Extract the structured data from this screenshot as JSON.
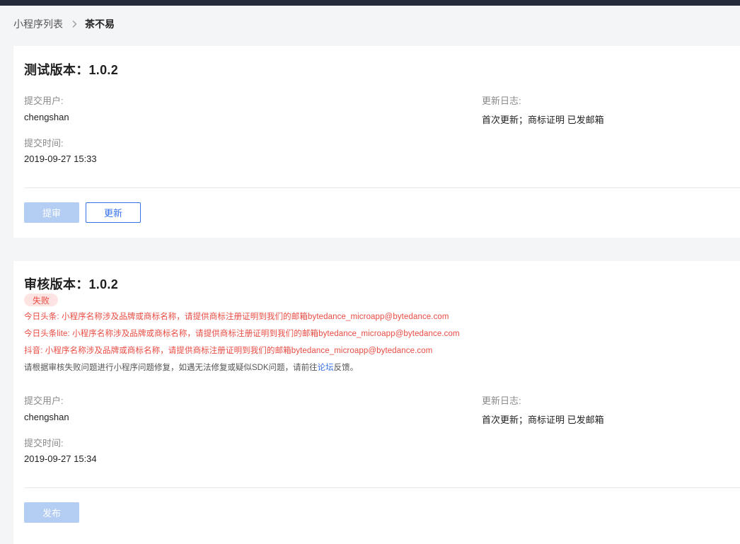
{
  "breadcrumb": {
    "parent": "小程序列表",
    "current": "茶不易"
  },
  "test_version": {
    "title": "测试版本：1.0.2",
    "submitter_label": "提交用户:",
    "submitter": "chengshan",
    "time_label": "提交时间:",
    "time": "2019-09-27 15:33",
    "changelog_label": "更新日志:",
    "changelog": "首次更新；商标证明 已发邮箱",
    "submit_review_label": "提审",
    "update_label": "更新"
  },
  "review_version": {
    "title": "审核版本：1.0.2",
    "status": "失败",
    "errors": [
      "今日头条: 小程序名称涉及品牌或商标名称，请提供商标注册证明到我们的邮箱bytedance_microapp@bytedance.com",
      "今日头条lite: 小程序名称涉及品牌或商标名称，请提供商标注册证明到我们的邮箱bytedance_microapp@bytedance.com",
      "抖音: 小程序名称涉及品牌或商标名称，请提供商标注册证明到我们的邮箱bytedance_microapp@bytedance.com"
    ],
    "hint_prefix": "请根据审核失败问题进行小程序问题修复，如遇无法修复或疑似SDK问题，请前往",
    "hint_link": "论坛",
    "hint_suffix": "反馈。",
    "submitter_label": "提交用户:",
    "submitter": "chengshan",
    "time_label": "提交时间:",
    "time": "2019-09-27 15:34",
    "changelog_label": "更新日志:",
    "changelog": "首次更新；商标证明 已发邮箱",
    "publish_label": "发布"
  },
  "colors": {
    "accent": "#3670e8",
    "error": "#e94b42",
    "disabled_button": "#b3cdf3",
    "topbar": "#252b3a"
  },
  "icons": {
    "breadcrumb_separator": "chevron-right-icon"
  }
}
